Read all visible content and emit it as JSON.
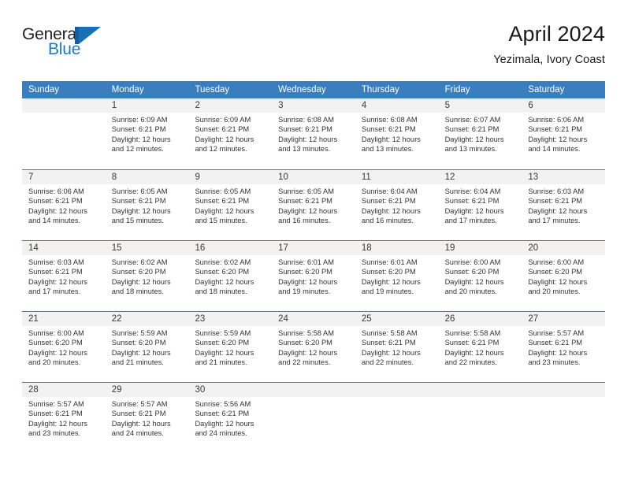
{
  "brand": {
    "name_top": "General",
    "name_bottom": "Blue",
    "accent_color": "#1a7bc4",
    "mark_color": "#1a6fb5"
  },
  "header": {
    "title": "April 2024",
    "subtitle": "Yezimala, Ivory Coast"
  },
  "theme": {
    "header_blue": "#3a7ebf",
    "daynum_band": "#f2f2f2",
    "text": "#333333"
  },
  "weekdays": [
    "Sunday",
    "Monday",
    "Tuesday",
    "Wednesday",
    "Thursday",
    "Friday",
    "Saturday"
  ],
  "weeks": [
    [
      {
        "day": "",
        "sunrise": "",
        "sunset": "",
        "daylight_line1": "",
        "daylight_line2": ""
      },
      {
        "day": "1",
        "sunrise": "Sunrise: 6:09 AM",
        "sunset": "Sunset: 6:21 PM",
        "daylight_line1": "Daylight: 12 hours",
        "daylight_line2": "and 12 minutes."
      },
      {
        "day": "2",
        "sunrise": "Sunrise: 6:09 AM",
        "sunset": "Sunset: 6:21 PM",
        "daylight_line1": "Daylight: 12 hours",
        "daylight_line2": "and 12 minutes."
      },
      {
        "day": "3",
        "sunrise": "Sunrise: 6:08 AM",
        "sunset": "Sunset: 6:21 PM",
        "daylight_line1": "Daylight: 12 hours",
        "daylight_line2": "and 13 minutes."
      },
      {
        "day": "4",
        "sunrise": "Sunrise: 6:08 AM",
        "sunset": "Sunset: 6:21 PM",
        "daylight_line1": "Daylight: 12 hours",
        "daylight_line2": "and 13 minutes."
      },
      {
        "day": "5",
        "sunrise": "Sunrise: 6:07 AM",
        "sunset": "Sunset: 6:21 PM",
        "daylight_line1": "Daylight: 12 hours",
        "daylight_line2": "and 13 minutes."
      },
      {
        "day": "6",
        "sunrise": "Sunrise: 6:06 AM",
        "sunset": "Sunset: 6:21 PM",
        "daylight_line1": "Daylight: 12 hours",
        "daylight_line2": "and 14 minutes."
      }
    ],
    [
      {
        "day": "7",
        "sunrise": "Sunrise: 6:06 AM",
        "sunset": "Sunset: 6:21 PM",
        "daylight_line1": "Daylight: 12 hours",
        "daylight_line2": "and 14 minutes."
      },
      {
        "day": "8",
        "sunrise": "Sunrise: 6:05 AM",
        "sunset": "Sunset: 6:21 PM",
        "daylight_line1": "Daylight: 12 hours",
        "daylight_line2": "and 15 minutes."
      },
      {
        "day": "9",
        "sunrise": "Sunrise: 6:05 AM",
        "sunset": "Sunset: 6:21 PM",
        "daylight_line1": "Daylight: 12 hours",
        "daylight_line2": "and 15 minutes."
      },
      {
        "day": "10",
        "sunrise": "Sunrise: 6:05 AM",
        "sunset": "Sunset: 6:21 PM",
        "daylight_line1": "Daylight: 12 hours",
        "daylight_line2": "and 16 minutes."
      },
      {
        "day": "11",
        "sunrise": "Sunrise: 6:04 AM",
        "sunset": "Sunset: 6:21 PM",
        "daylight_line1": "Daylight: 12 hours",
        "daylight_line2": "and 16 minutes."
      },
      {
        "day": "12",
        "sunrise": "Sunrise: 6:04 AM",
        "sunset": "Sunset: 6:21 PM",
        "daylight_line1": "Daylight: 12 hours",
        "daylight_line2": "and 17 minutes."
      },
      {
        "day": "13",
        "sunrise": "Sunrise: 6:03 AM",
        "sunset": "Sunset: 6:21 PM",
        "daylight_line1": "Daylight: 12 hours",
        "daylight_line2": "and 17 minutes."
      }
    ],
    [
      {
        "day": "14",
        "sunrise": "Sunrise: 6:03 AM",
        "sunset": "Sunset: 6:21 PM",
        "daylight_line1": "Daylight: 12 hours",
        "daylight_line2": "and 17 minutes."
      },
      {
        "day": "15",
        "sunrise": "Sunrise: 6:02 AM",
        "sunset": "Sunset: 6:20 PM",
        "daylight_line1": "Daylight: 12 hours",
        "daylight_line2": "and 18 minutes."
      },
      {
        "day": "16",
        "sunrise": "Sunrise: 6:02 AM",
        "sunset": "Sunset: 6:20 PM",
        "daylight_line1": "Daylight: 12 hours",
        "daylight_line2": "and 18 minutes."
      },
      {
        "day": "17",
        "sunrise": "Sunrise: 6:01 AM",
        "sunset": "Sunset: 6:20 PM",
        "daylight_line1": "Daylight: 12 hours",
        "daylight_line2": "and 19 minutes."
      },
      {
        "day": "18",
        "sunrise": "Sunrise: 6:01 AM",
        "sunset": "Sunset: 6:20 PM",
        "daylight_line1": "Daylight: 12 hours",
        "daylight_line2": "and 19 minutes."
      },
      {
        "day": "19",
        "sunrise": "Sunrise: 6:00 AM",
        "sunset": "Sunset: 6:20 PM",
        "daylight_line1": "Daylight: 12 hours",
        "daylight_line2": "and 20 minutes."
      },
      {
        "day": "20",
        "sunrise": "Sunrise: 6:00 AM",
        "sunset": "Sunset: 6:20 PM",
        "daylight_line1": "Daylight: 12 hours",
        "daylight_line2": "and 20 minutes."
      }
    ],
    [
      {
        "day": "21",
        "sunrise": "Sunrise: 6:00 AM",
        "sunset": "Sunset: 6:20 PM",
        "daylight_line1": "Daylight: 12 hours",
        "daylight_line2": "and 20 minutes."
      },
      {
        "day": "22",
        "sunrise": "Sunrise: 5:59 AM",
        "sunset": "Sunset: 6:20 PM",
        "daylight_line1": "Daylight: 12 hours",
        "daylight_line2": "and 21 minutes."
      },
      {
        "day": "23",
        "sunrise": "Sunrise: 5:59 AM",
        "sunset": "Sunset: 6:20 PM",
        "daylight_line1": "Daylight: 12 hours",
        "daylight_line2": "and 21 minutes."
      },
      {
        "day": "24",
        "sunrise": "Sunrise: 5:58 AM",
        "sunset": "Sunset: 6:20 PM",
        "daylight_line1": "Daylight: 12 hours",
        "daylight_line2": "and 22 minutes."
      },
      {
        "day": "25",
        "sunrise": "Sunrise: 5:58 AM",
        "sunset": "Sunset: 6:21 PM",
        "daylight_line1": "Daylight: 12 hours",
        "daylight_line2": "and 22 minutes."
      },
      {
        "day": "26",
        "sunrise": "Sunrise: 5:58 AM",
        "sunset": "Sunset: 6:21 PM",
        "daylight_line1": "Daylight: 12 hours",
        "daylight_line2": "and 22 minutes."
      },
      {
        "day": "27",
        "sunrise": "Sunrise: 5:57 AM",
        "sunset": "Sunset: 6:21 PM",
        "daylight_line1": "Daylight: 12 hours",
        "daylight_line2": "and 23 minutes."
      }
    ],
    [
      {
        "day": "28",
        "sunrise": "Sunrise: 5:57 AM",
        "sunset": "Sunset: 6:21 PM",
        "daylight_line1": "Daylight: 12 hours",
        "daylight_line2": "and 23 minutes."
      },
      {
        "day": "29",
        "sunrise": "Sunrise: 5:57 AM",
        "sunset": "Sunset: 6:21 PM",
        "daylight_line1": "Daylight: 12 hours",
        "daylight_line2": "and 24 minutes."
      },
      {
        "day": "30",
        "sunrise": "Sunrise: 5:56 AM",
        "sunset": "Sunset: 6:21 PM",
        "daylight_line1": "Daylight: 12 hours",
        "daylight_line2": "and 24 minutes."
      },
      {
        "day": "",
        "sunrise": "",
        "sunset": "",
        "daylight_line1": "",
        "daylight_line2": ""
      },
      {
        "day": "",
        "sunrise": "",
        "sunset": "",
        "daylight_line1": "",
        "daylight_line2": ""
      },
      {
        "day": "",
        "sunrise": "",
        "sunset": "",
        "daylight_line1": "",
        "daylight_line2": ""
      },
      {
        "day": "",
        "sunrise": "",
        "sunset": "",
        "daylight_line1": "",
        "daylight_line2": ""
      }
    ]
  ]
}
